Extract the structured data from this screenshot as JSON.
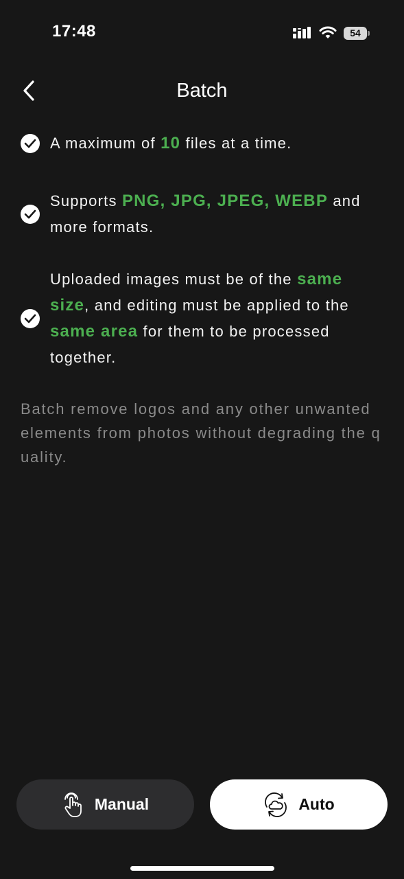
{
  "status_bar": {
    "time": "17:48",
    "battery": "54"
  },
  "nav": {
    "title": "Batch"
  },
  "features": [
    {
      "parts": [
        "A maximum of ",
        "10",
        " files at a time."
      ]
    },
    {
      "parts": [
        "Supports ",
        "PNG, JPG, JPEG, WEBP",
        " and more formats."
      ]
    },
    {
      "parts": [
        "Uploaded images must be of the ",
        "same size",
        ", and editing must be applied to the ",
        "same area",
        " for them to be processed together."
      ]
    }
  ],
  "description": "Batch remove logos and any other unwanted elements from photos without degrading the quality.",
  "buttons": {
    "manual_label": "Manual",
    "auto_label": "Auto"
  },
  "colors": {
    "background": "#171717",
    "highlight": "#4caf50",
    "description_text": "#8a8a8a",
    "manual_button_bg": "#2d2d2f",
    "auto_button_bg": "#ffffff"
  },
  "icons": {
    "back": "chevron-left-icon",
    "check": "check-circle-icon",
    "manual": "tap-hand-icon",
    "auto": "cloud-sync-icon"
  }
}
